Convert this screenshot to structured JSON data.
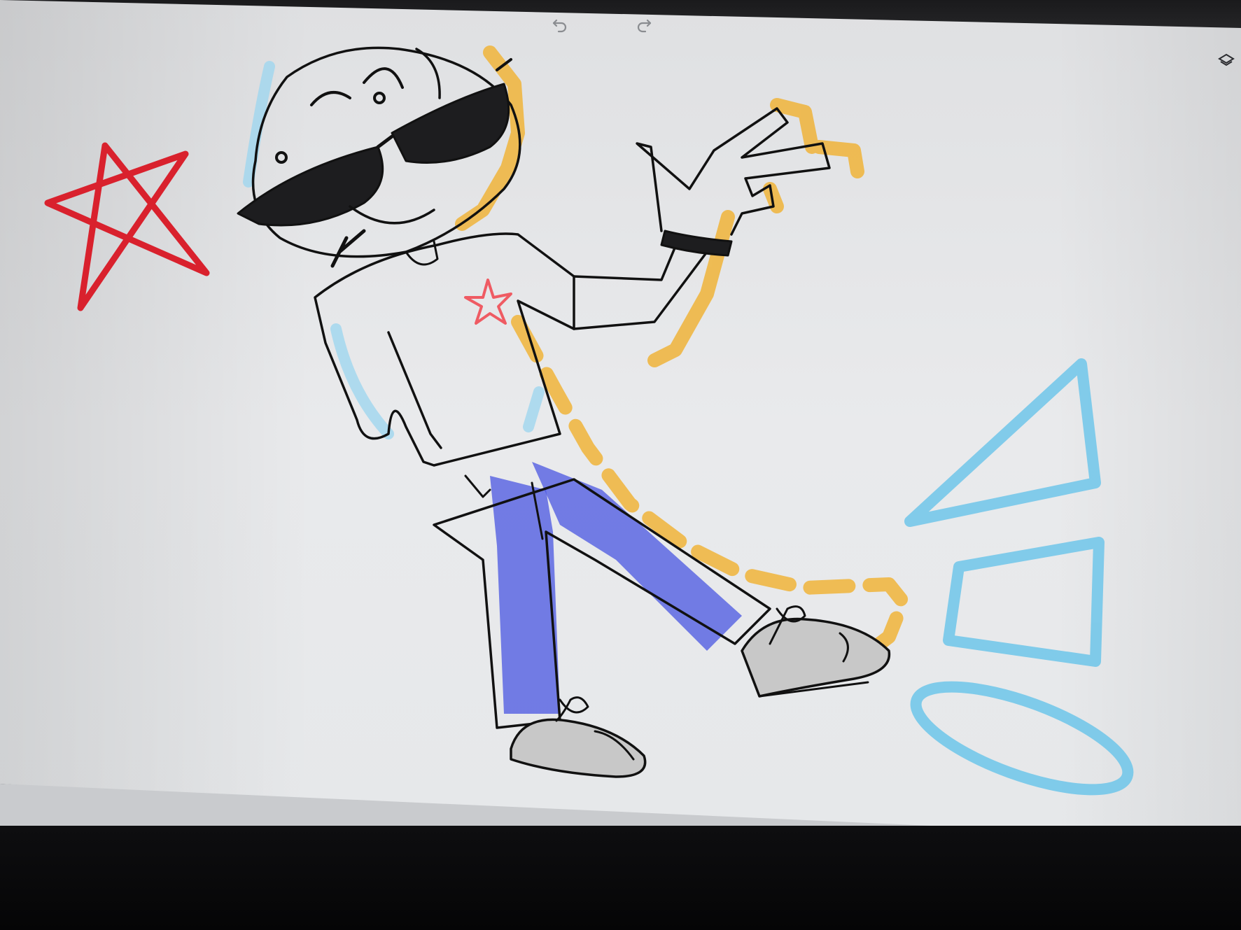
{
  "app": {
    "toolbar": {
      "undo_icon": "undo-icon",
      "redo_icon": "redo-icon",
      "layers_icon": "layers-icon"
    }
  },
  "canvas": {
    "background_color": "#e9ebee",
    "strokes": {
      "outline_color": "#111111",
      "star_color": "#d9212d",
      "shirt_star_color": "#ef5b63",
      "glasses_color": "#1d1d1f",
      "pants_color": "#4a56e2",
      "shadow_color": "#f0b43a",
      "shape_color": "#6ec6ea",
      "shoe_gray": "#9a9a9a"
    },
    "shapes": [
      "star",
      "triangle",
      "square",
      "circle"
    ]
  }
}
